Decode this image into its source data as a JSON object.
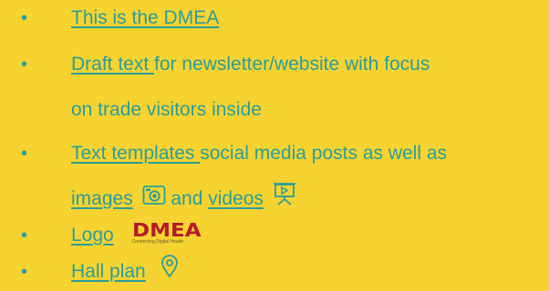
{
  "items": [
    {
      "link": "This is the DMEA",
      "text": ""
    },
    {
      "link": "Draft text ",
      "text_line1": "for newsletter/website with focus",
      "text_line2": "on trade visitors inside"
    },
    {
      "link": "Text templates ",
      "text_line1": "social media posts as well as",
      "link2": "images",
      "text_mid": " and ",
      "link3": "videos"
    },
    {
      "link": "Logo",
      "logo_text": "DMEA",
      "logo_sub": "Connecting Digital Health"
    },
    {
      "link": "Hall plan"
    }
  ],
  "bullet": "•",
  "colors": {
    "background": "#f6d330",
    "text": "#2a9d9b",
    "logo": "#b31b2a"
  },
  "icons": [
    "camera-icon",
    "presentation-icon",
    "location-pin-icon"
  ]
}
